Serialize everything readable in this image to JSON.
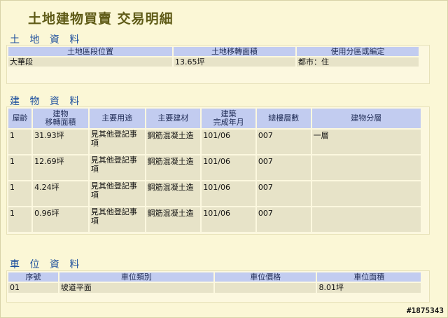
{
  "page": {
    "title": "土地建物買賣 交易明細",
    "watermark": "#1875343"
  },
  "land": {
    "title": "土 地 資 料",
    "headers": [
      "土地區段位置",
      "土地移轉面積",
      "使用分區或編定"
    ],
    "rows": [
      [
        "大華段",
        "13.65坪",
        "都市：住"
      ]
    ]
  },
  "building": {
    "title": "建 物 資 料",
    "headers": [
      "屋齡",
      "建物\n移轉面積",
      "主要用途",
      "主要建材",
      "建築\n完成年月",
      "總樓層數",
      "建物分層"
    ],
    "rows": [
      [
        "1",
        "31.93坪",
        "見其他登記事\n項",
        "鋼筋混凝土造",
        "101/06",
        "007",
        "一層"
      ],
      [
        "1",
        "12.69坪",
        "見其他登記事\n項",
        "鋼筋混凝土造",
        "101/06",
        "007",
        ""
      ],
      [
        "1",
        "4.24坪",
        "見其他登記事\n項",
        "鋼筋混凝土造",
        "101/06",
        "007",
        ""
      ],
      [
        "1",
        "0.96坪",
        "見其他登記事\n項",
        "鋼筋混凝土造",
        "101/06",
        "007",
        ""
      ]
    ]
  },
  "parking": {
    "title": "車 位 資 料",
    "headers": [
      "序號",
      "車位類別",
      "車位價格",
      "車位面積"
    ],
    "rows": [
      [
        "01",
        "坡道平面",
        "",
        "8.01坪"
      ]
    ]
  }
}
